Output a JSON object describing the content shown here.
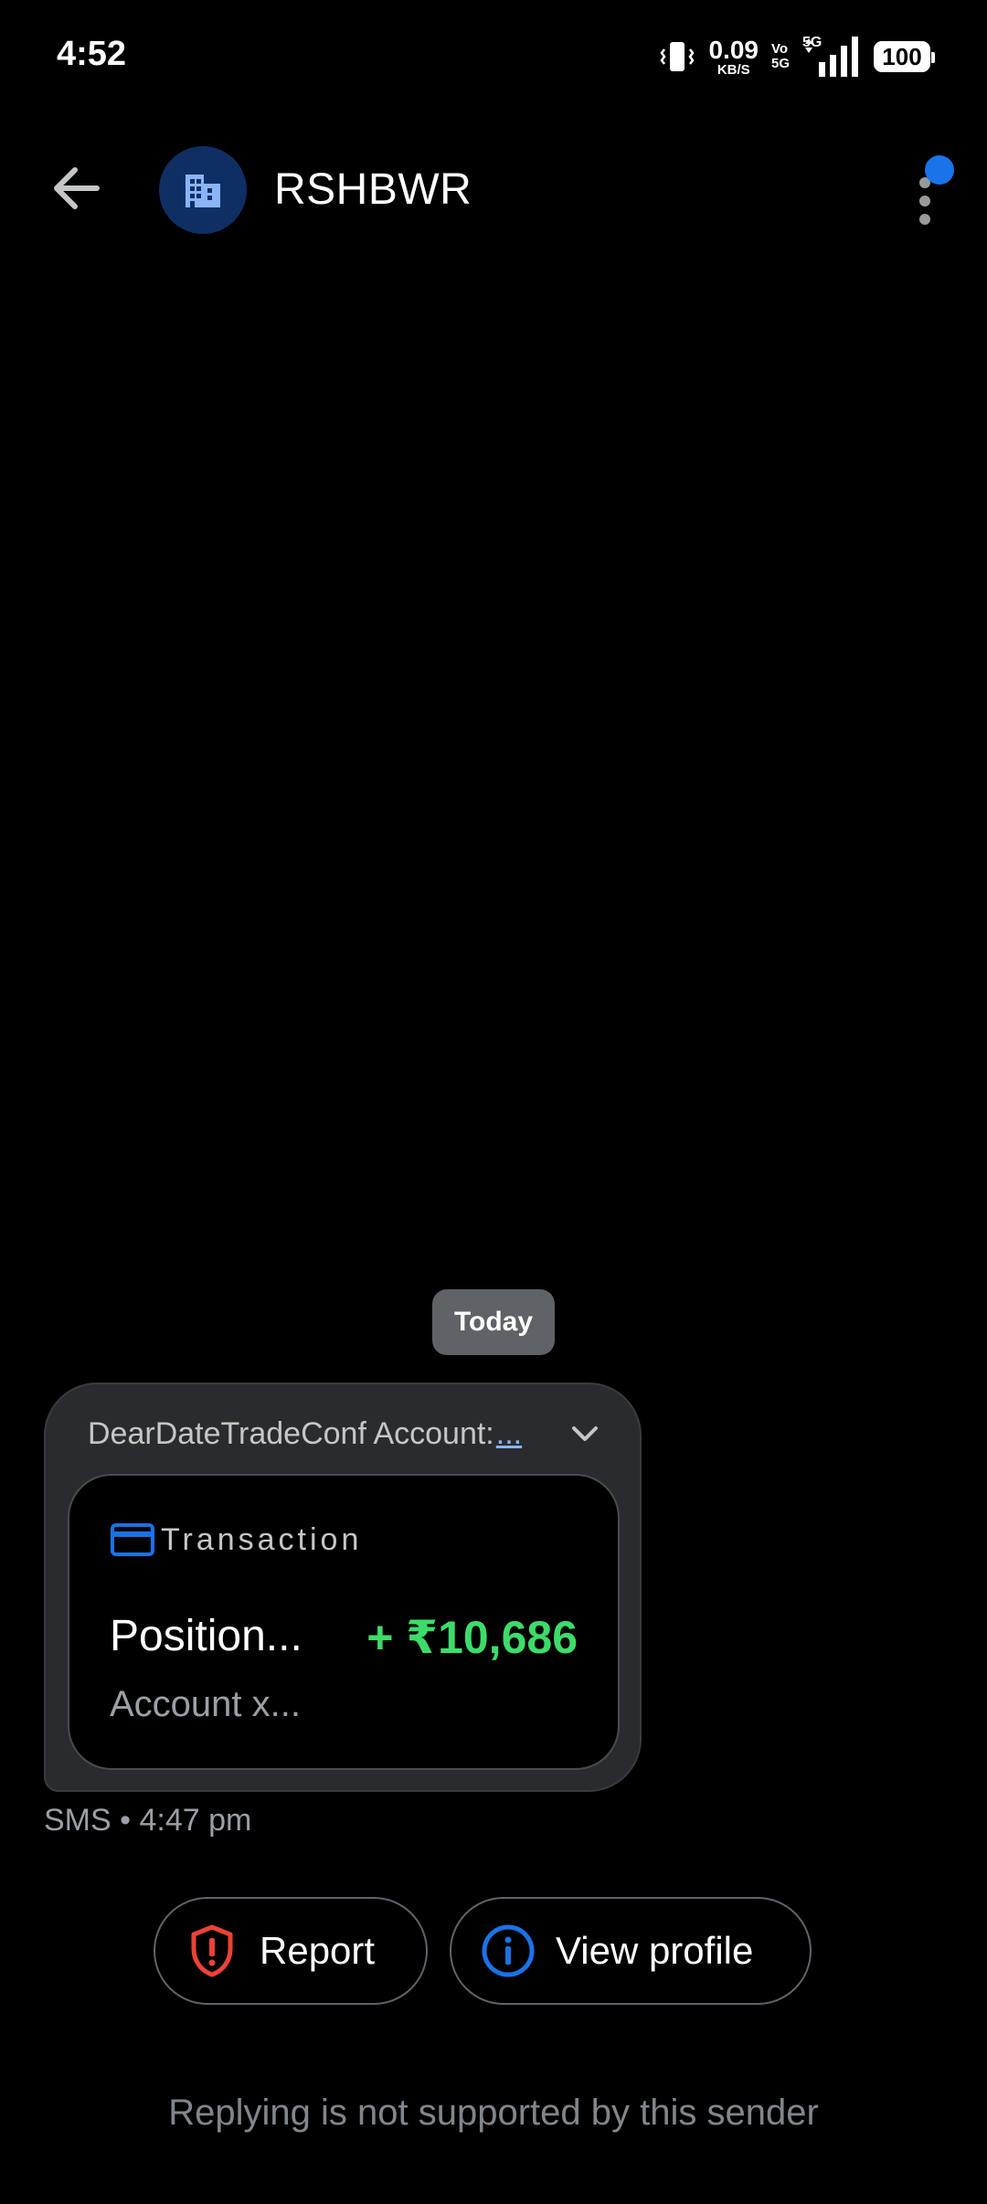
{
  "status_bar": {
    "time": "4:52",
    "net_speed_value": "0.09",
    "net_speed_unit": "KB/S",
    "volte_top": "Vo",
    "volte_bottom": "5G",
    "network_type": "5G",
    "battery": "100"
  },
  "app_bar": {
    "sender_name": "RSHBWR",
    "avatar_icon": "building-icon",
    "back_icon": "arrow-back-icon",
    "menu_icon": "more-vert-icon",
    "badge_color": "#1a73e8"
  },
  "conversation": {
    "date_chip": "Today",
    "message": {
      "preview_text": "DearDateTradeConf Account:",
      "preview_more": "...",
      "card": {
        "label": "Transaction",
        "title": "Position...",
        "amount": "+ ₹10,686",
        "subtitle": "Account x...",
        "amount_color": "#3ddc6a"
      },
      "meta": "SMS • 4:47 pm"
    }
  },
  "actions": {
    "report_label": "Report",
    "view_profile_label": "View profile"
  },
  "footer": {
    "note": "Replying is not supported by this sender"
  }
}
